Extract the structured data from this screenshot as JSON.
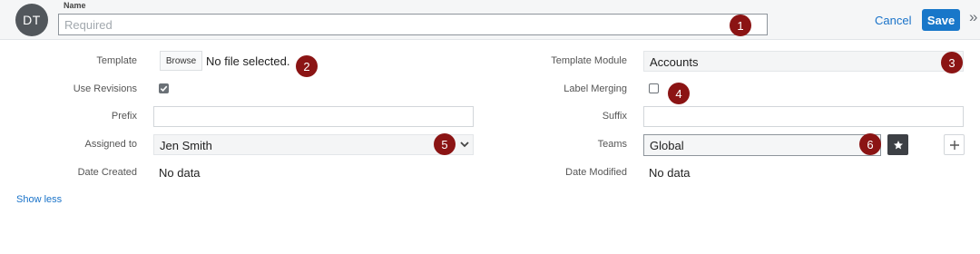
{
  "header": {
    "avatar_initials": "DT",
    "name_label": "Name",
    "name_placeholder": "Required",
    "cancel_label": "Cancel",
    "save_label": "Save",
    "collapse_glyph": "»"
  },
  "fields": {
    "template": {
      "label": "Template",
      "browse_label": "Browse",
      "file_status": "No file selected."
    },
    "template_module": {
      "label": "Template Module",
      "value": "Accounts"
    },
    "use_revisions": {
      "label": "Use Revisions",
      "checked": true
    },
    "label_merging": {
      "label": "Label Merging",
      "checked": false
    },
    "prefix": {
      "label": "Prefix",
      "value": ""
    },
    "suffix": {
      "label": "Suffix",
      "value": ""
    },
    "assigned_to": {
      "label": "Assigned to",
      "value": "Jen Smith"
    },
    "teams": {
      "label": "Teams",
      "value": "Global"
    },
    "date_created": {
      "label": "Date Created",
      "value": "No data"
    },
    "date_modified": {
      "label": "Date Modified",
      "value": "No data"
    }
  },
  "show_less_label": "Show less",
  "markers": [
    "1",
    "2",
    "3",
    "4",
    "5",
    "6"
  ],
  "colors": {
    "accent": "#1877c9",
    "marker": "#8b1414",
    "avatar": "#52575c"
  },
  "icons": [
    "chevron-down-icon",
    "star-icon",
    "plus-icon",
    "checkmark-icon",
    "double-chevron-right-icon"
  ]
}
